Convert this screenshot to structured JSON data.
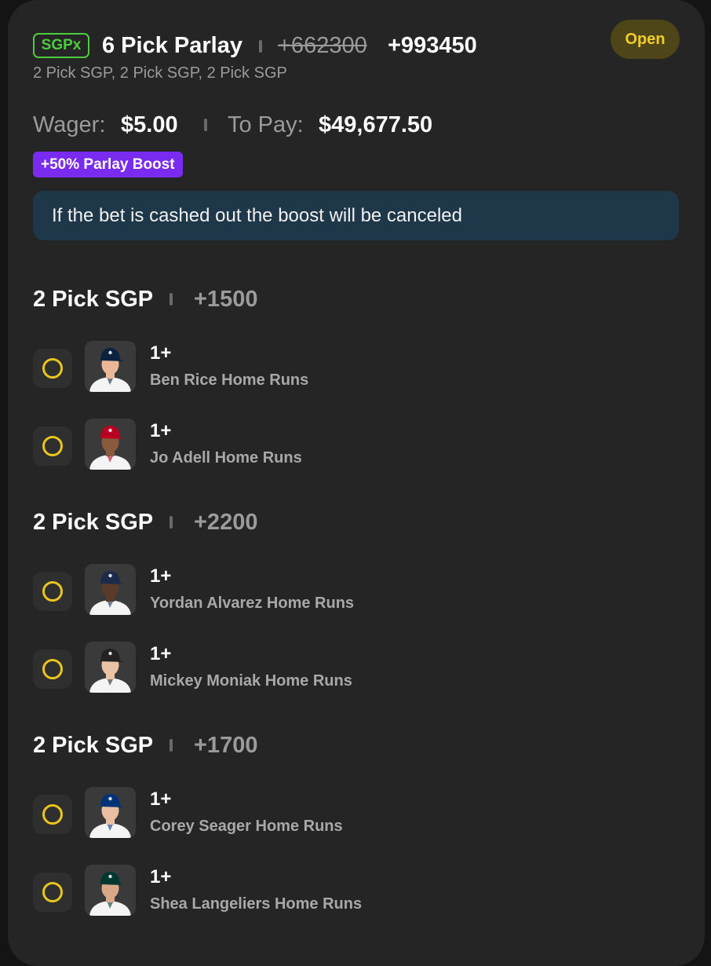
{
  "header": {
    "badge": "SGPx",
    "title": "6 Pick Parlay",
    "old_odds": "+662300",
    "new_odds": "+993450",
    "subtitle": "2 Pick SGP, 2 Pick SGP, 2 Pick SGP",
    "status": "Open"
  },
  "wager": {
    "wager_label": "Wager:",
    "wager_value": "$5.00",
    "pay_label": "To Pay:",
    "pay_value": "$49,677.50"
  },
  "boost": {
    "label": "+50% Parlay Boost",
    "notice": "If the bet is cashed out the boost will be canceled"
  },
  "groups": [
    {
      "name": "2 Pick SGP",
      "odds": "+1500",
      "legs": [
        {
          "line": "1+",
          "desc": "Ben Rice Home Runs",
          "team_color": "#0c2340",
          "jersey": "#f4f4f4",
          "skin": "#e8b898"
        },
        {
          "line": "1+",
          "desc": "Jo Adell Home Runs",
          "team_color": "#ba0021",
          "jersey": "#f4f4f4",
          "skin": "#8a5a3c"
        }
      ]
    },
    {
      "name": "2 Pick SGP",
      "odds": "+2200",
      "legs": [
        {
          "line": "1+",
          "desc": "Yordan Alvarez Home Runs",
          "team_color": "#1d2b4a",
          "jersey": "#f4f4f4",
          "skin": "#5a3a28"
        },
        {
          "line": "1+",
          "desc": "Mickey Moniak Home Runs",
          "team_color": "#222222",
          "jersey": "#f4f4f4",
          "skin": "#eac2a4"
        }
      ]
    },
    {
      "name": "2 Pick SGP",
      "odds": "+1700",
      "legs": [
        {
          "line": "1+",
          "desc": "Corey Seager Home Runs",
          "team_color": "#003278",
          "jersey": "#f4f4f4",
          "skin": "#e8bfa0"
        },
        {
          "line": "1+",
          "desc": "Shea Langeliers Home Runs",
          "team_color": "#003831",
          "jersey": "#f4f4f4",
          "skin": "#d9a888"
        }
      ]
    }
  ]
}
